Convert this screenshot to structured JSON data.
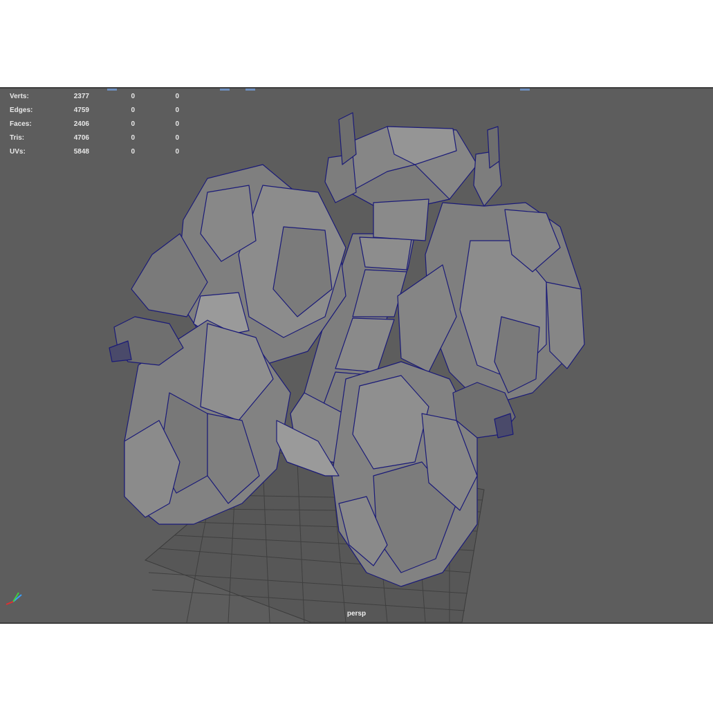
{
  "hud": {
    "rows": [
      {
        "label": "Verts:",
        "c1": "2377",
        "c2": "0",
        "c3": "0"
      },
      {
        "label": "Edges:",
        "c1": "4759",
        "c2": "0",
        "c3": "0"
      },
      {
        "label": "Faces:",
        "c1": "2406",
        "c2": "0",
        "c3": "0"
      },
      {
        "label": "Tris:",
        "c1": "4706",
        "c2": "0",
        "c3": "0"
      },
      {
        "label": "UVs:",
        "c1": "5848",
        "c2": "0",
        "c3": "0"
      }
    ]
  },
  "viewport": {
    "camera": "persp"
  },
  "colors": {
    "background": "#5d5d5d",
    "wireframe": "#1a1a78",
    "mesh_fill": "#858585",
    "hud_text": "#e8e8e8"
  },
  "icons": [
    "axis-gizmo-icon"
  ]
}
